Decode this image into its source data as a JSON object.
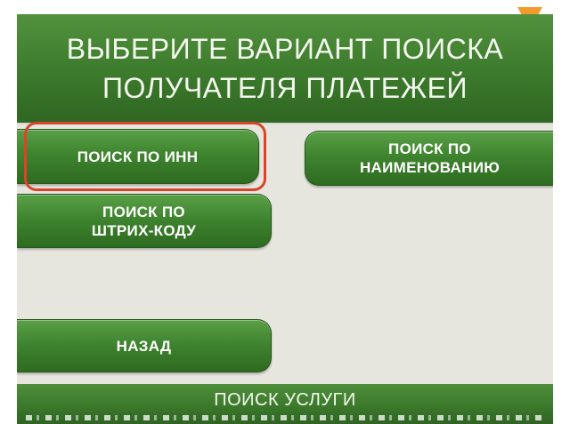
{
  "header": {
    "title_line1": "ВЫБЕРИТЕ ВАРИАНТ ПОИСКА",
    "title_line2": "ПОЛУЧАТЕЛЯ ПЛАТЕЖЕЙ"
  },
  "buttons": {
    "search_inn": "ПОИСК ПО ИНН",
    "search_name_line1": "ПОИСК ПО",
    "search_name_line2": "НАИМЕНОВАНИЮ",
    "search_barcode_line1": "ПОИСК ПО",
    "search_barcode_line2": "ШТРИХ-КОДУ",
    "back": "НАЗАД"
  },
  "footer": {
    "title": "ПОИСК УСЛУГИ"
  },
  "colors": {
    "button_green": "#3f842f",
    "header_green": "#3c7a2c",
    "background": "#e6e5de",
    "highlight_red": "#d9452b",
    "marker_orange": "#f29a2b"
  },
  "icons": {
    "corner_marker": "orange-triangle-down-icon"
  }
}
